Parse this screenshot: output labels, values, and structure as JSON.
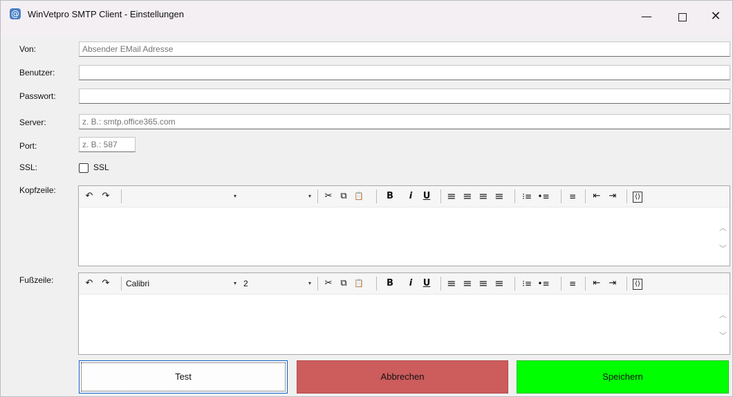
{
  "window": {
    "title": "WinVetpro SMTP Client - Einstellungen",
    "app_icon": "@",
    "controls": {
      "minimize": "—",
      "close": "✕"
    }
  },
  "form": {
    "von": {
      "label": "Von:",
      "value": "",
      "placeholder": "Absender EMail Adresse"
    },
    "benutzer": {
      "label": "Benutzer:",
      "value": ""
    },
    "passwort": {
      "label": "Passwort:",
      "value": ""
    },
    "server": {
      "label": "Server:",
      "value": "",
      "placeholder": "z. B.: smtp.office365.com"
    },
    "port": {
      "label": "Port:",
      "value": "",
      "placeholder": "z. B.: 587"
    },
    "ssl": {
      "label": "SSL:",
      "checkbox_label": "SSL",
      "checked": false
    }
  },
  "toolbar": {
    "undo": "↶",
    "redo": "↷",
    "cut": "✂",
    "copy": "⧉",
    "paste": "📋",
    "bold": "B",
    "italic": "i",
    "underline": "U",
    "align_left": "≡",
    "align_center": "≡",
    "align_right": "≡",
    "justify": "≡",
    "numbered_list": "⁝≡",
    "bullet_list": "•≡",
    "paragraph": "≡",
    "outdent": "⇤",
    "indent": "⇥",
    "source": "⟨⟩",
    "dropdown_arrow": "▾"
  },
  "kopfzeile": {
    "label": "Kopfzeile:",
    "font": "",
    "size": ""
  },
  "fusszeile": {
    "label": "Fußzeile:",
    "font": "Calibri",
    "size": "2"
  },
  "scroll": {
    "up": "︿",
    "down": "﹀"
  },
  "buttons": {
    "test": "Test",
    "cancel": "Abbrechen",
    "save": "Speichern"
  },
  "colors": {
    "cancel": "#cd5c5c",
    "save": "#00ff00",
    "focus_border": "#0f5cc7"
  }
}
